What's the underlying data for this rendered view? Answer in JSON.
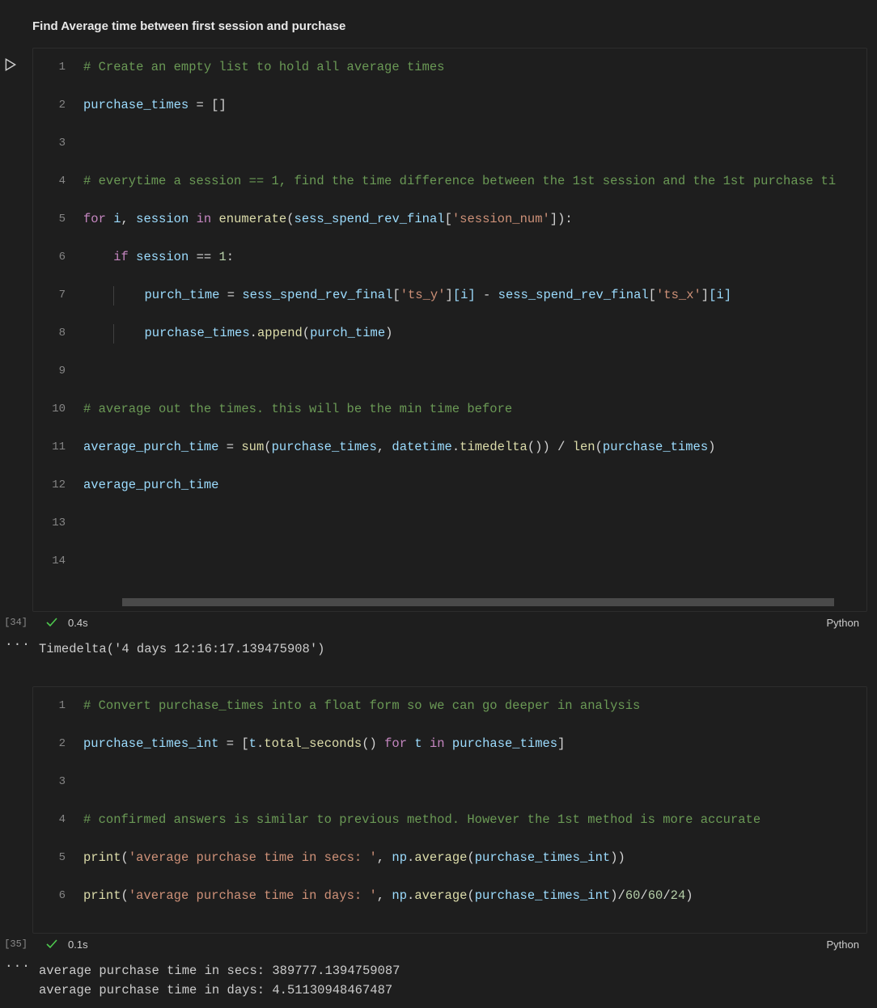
{
  "markdown_title": "Find Average time between first session and purchase",
  "cell1": {
    "exec_count": "[34]",
    "timing": "0.4s",
    "language": "Python",
    "lines": {
      "l1": "# Create an empty list to hold all average times",
      "l4": "# everytime a session == 1, find the time difference between the 1st session and the 1st purchase ti",
      "l10": "# average out the times. this will be the min time before"
    },
    "tokens": {
      "purchase_times": "purchase_times",
      "eq": " = ",
      "brackets_open": "[",
      "brackets_close": "]",
      "for": "for",
      "i": "i",
      "comma": ", ",
      "session": "session",
      "in": "in",
      "enumerate": "enumerate",
      "paren_open": "(",
      "sess_spend_rev_final": "sess_spend_rev_final",
      "session_num_str": "'session_num'",
      "paren_close": ")",
      "colon": ":",
      "if": "if",
      "eqeq": " == ",
      "one": "1",
      "purch_time": "purch_time",
      "ts_y_str": "'ts_y'",
      "idx_i": "[i]",
      "minus": " - ",
      "ts_x_str": "'ts_x'",
      "append": "append",
      "dot": ".",
      "average_purch_time": "average_purch_time",
      "sum": "sum",
      "datetime": "datetime",
      "timedelta": "timedelta",
      "empty_call": "()",
      "div": " / ",
      "len": "len"
    },
    "output": "Timedelta('4 days 12:16:17.139475908')"
  },
  "cell2": {
    "exec_count": "[35]",
    "timing": "0.1s",
    "language": "Python",
    "lines": {
      "l1": "# Convert purchase_times into a float form so we can go deeper in analysis",
      "l4": "# confirmed answers is similar to previous method. However the 1st method is more accurate"
    },
    "tokens": {
      "purchase_times_int": "purchase_times_int",
      "eq": " = ",
      "lbr": "[",
      "t": "t",
      "dot": ".",
      "total_seconds": "total_seconds",
      "empty_call": "()",
      "sp": " ",
      "for": "for",
      "in": "in",
      "purchase_times": "purchase_times",
      "rbr": "]",
      "print": "print",
      "po": "(",
      "secs_label": "'average purchase time in secs: '",
      "days_label": "'average purchase time in days: '",
      "comma": ", ",
      "np": "np",
      "average": "average",
      "pc": ")",
      "sixty": "60",
      "twentyfour": "24",
      "slash": "/"
    },
    "output_line1": "average purchase time in secs:  389777.1394759087",
    "output_line2": "average purchase time in days:  4.51130948467487"
  },
  "icons": {
    "ellipsis": "…"
  }
}
